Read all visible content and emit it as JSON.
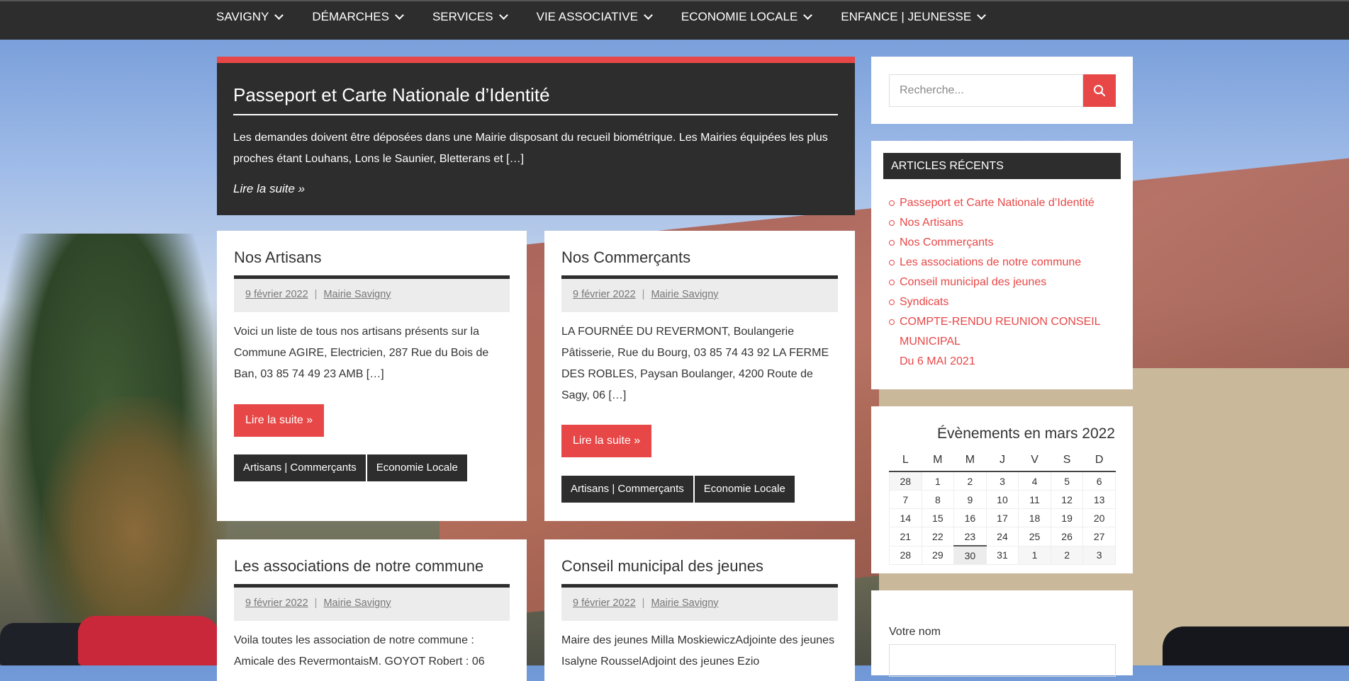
{
  "nav": {
    "items": [
      "SAVIGNY",
      "DÉMARCHES",
      "SERVICES",
      "VIE ASSOCIATIVE",
      "ECONOMIE LOCALE",
      "ENFANCE | JEUNESSE"
    ]
  },
  "featured": {
    "title": "Passeport et Carte Nationale d’Identité",
    "excerpt": "Les demandes doivent être déposées dans une Mairie disposant du recueil biométrique. Les Mairies équipées les plus proches étant Louhans, Lons le Saunier, Bletterans et […]",
    "more": "Lire la suite »"
  },
  "posts": [
    {
      "title": "Nos Artisans",
      "date": "9 février 2022",
      "author": "Mairie Savigny",
      "excerpt": "Voici un liste de tous nos artisans présents sur la Commune AGIRE, Electricien, 287 Rue du Bois de Ban, 03 85 74 49 23 AMB […]",
      "button": "Lire la suite »",
      "tags": [
        "Artisans | Commerçants",
        "Economie Locale"
      ]
    },
    {
      "title": "Nos Commerçants",
      "date": "9 février 2022",
      "author": "Mairie Savigny",
      "excerpt": "LA FOURNÉE DU REVERMONT, Boulangerie Pâtisserie, Rue du Bourg, 03 85 74 43 92 LA FERME DES ROBLES, Paysan Boulanger, 4200 Route de Sagy, 06 […]",
      "button": "Lire la suite »",
      "tags": [
        "Artisans | Commerçants",
        "Economie Locale"
      ]
    },
    {
      "title": "Les associations de notre commune",
      "date": "9 février 2022",
      "author": "Mairie Savigny",
      "excerpt": "Voila toutes les association de notre commune : Amicale des RevermontaisM. GOYOT Robert : 06"
    },
    {
      "title": "Conseil municipal des jeunes",
      "date": "9 février 2022",
      "author": "Mairie Savigny",
      "excerpt": "Maire des jeunes Milla MoskiewiczAdjointe des jeunes Isalyne RousselAdjoint des jeunes Ezio"
    }
  ],
  "search": {
    "placeholder": "Recherche..."
  },
  "recent": {
    "title": "ARTICLES RÉCENTS",
    "items": [
      "Passeport et Carte Nationale d’Identité",
      "Nos Artisans",
      "Nos Commerçants",
      "Les associations de notre commune",
      "Conseil municipal des jeunes",
      "Syndicats",
      "COMPTE-RENDU REUNION CONSEIL MUNICIPAL",
      "Du 6 MAI 2021"
    ]
  },
  "calendar": {
    "title": "Évènements en mars 2022",
    "days": [
      "L",
      "M",
      "M",
      "J",
      "V",
      "S",
      "D"
    ],
    "weeks": [
      [
        "28",
        "1",
        "2",
        "3",
        "4",
        "5",
        "6"
      ],
      [
        "7",
        "8",
        "9",
        "10",
        "11",
        "12",
        "13"
      ],
      [
        "14",
        "15",
        "16",
        "17",
        "18",
        "19",
        "20"
      ],
      [
        "21",
        "22",
        "23",
        "24",
        "25",
        "26",
        "27"
      ],
      [
        "28",
        "29",
        "30",
        "31",
        "1",
        "2",
        "3"
      ]
    ],
    "today": "30"
  },
  "contact": {
    "name_label": "Votre nom"
  },
  "colors": {
    "accent": "#e84747",
    "dark": "#2d2d2d"
  }
}
